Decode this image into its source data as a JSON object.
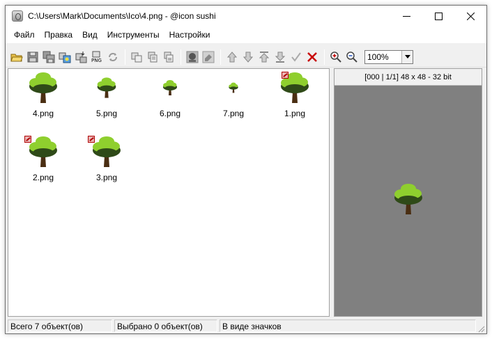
{
  "window": {
    "title": "C:\\Users\\Mark\\Documents\\Ico\\4.png - @icon sushi",
    "app_icon": "app-icon"
  },
  "menu": [
    "Файл",
    "Правка",
    "Вид",
    "Инструменты",
    "Настройки"
  ],
  "toolbar": {
    "icons": [
      "open-folder-icon",
      "save-icon",
      "save-all-icon",
      "convert-icon",
      "export-icon",
      "png-icon",
      "refresh-icon",
      "copy-icon",
      "copy-2-icon",
      "copy-3-icon",
      "mask-icon",
      "erase-icon",
      "move-up-icon",
      "move-down-icon",
      "move-top-icon",
      "move-bottom-icon",
      "check-icon",
      "delete-icon",
      "zoom-in-icon",
      "zoom-out-icon"
    ],
    "zoom_value": "100%"
  },
  "icons": [
    {
      "label": "4.png",
      "size": 48,
      "flagged": false
    },
    {
      "label": "5.png",
      "size": 32,
      "flagged": false
    },
    {
      "label": "6.png",
      "size": 24,
      "flagged": false
    },
    {
      "label": "7.png",
      "size": 16,
      "flagged": false
    },
    {
      "label": "1.png",
      "size": 48,
      "flagged": true
    },
    {
      "label": "2.png",
      "size": 48,
      "flagged": true
    },
    {
      "label": "3.png",
      "size": 48,
      "flagged": true
    }
  ],
  "preview": {
    "info": "[000 | 1/1] 48 x 48 - 32 bit"
  },
  "status": {
    "total": "Всего 7 объект(ов)",
    "selected": "Выбрано 0 объект(ов)",
    "view": "В виде значков"
  },
  "colors": {
    "tree_light": "#8fcf2e",
    "tree_dark": "#2f4a18",
    "trunk": "#4a2e12",
    "preview_bg": "#808080",
    "delete_red": "#c80000"
  }
}
